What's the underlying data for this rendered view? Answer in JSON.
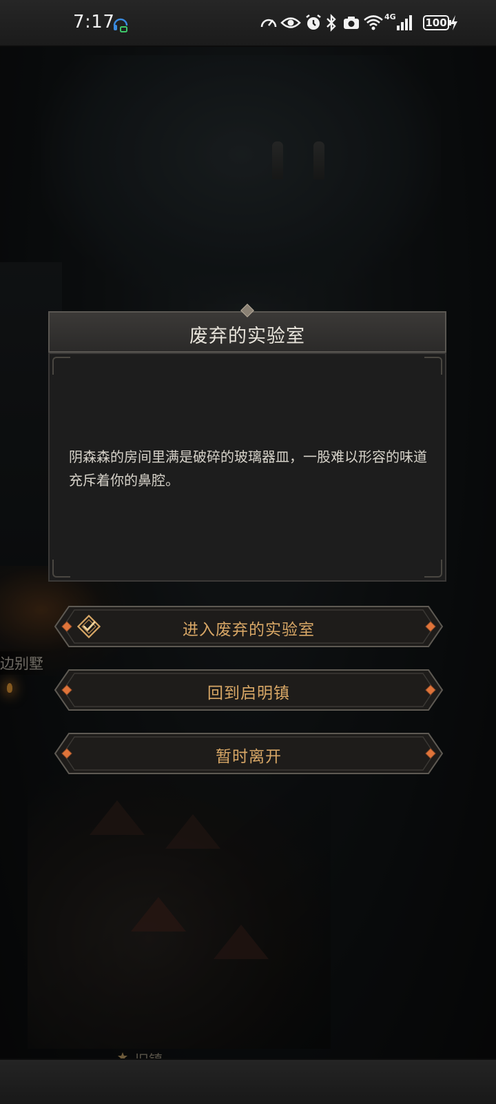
{
  "status_bar": {
    "time": "7:17",
    "battery": "100",
    "network": "4G"
  },
  "map": {
    "location_label": "边别墅",
    "bottom_hint": "旧镇"
  },
  "dialog": {
    "title": "废弃的实验室",
    "description": "阴森森的房间里满是破碎的玻璃器皿，一股难以形容的味道充斥着你的鼻腔。"
  },
  "choices": [
    {
      "label": "进入废弃的实验室",
      "icon": "diamond-check-icon"
    },
    {
      "label": "回到启明镇"
    },
    {
      "label": "暂时离开"
    }
  ],
  "colors": {
    "choice_text": "#d8a766",
    "choice_gem": "#e0743a",
    "dialog_bg": "#1d1d1d",
    "title_bar_bg": "#343230"
  }
}
